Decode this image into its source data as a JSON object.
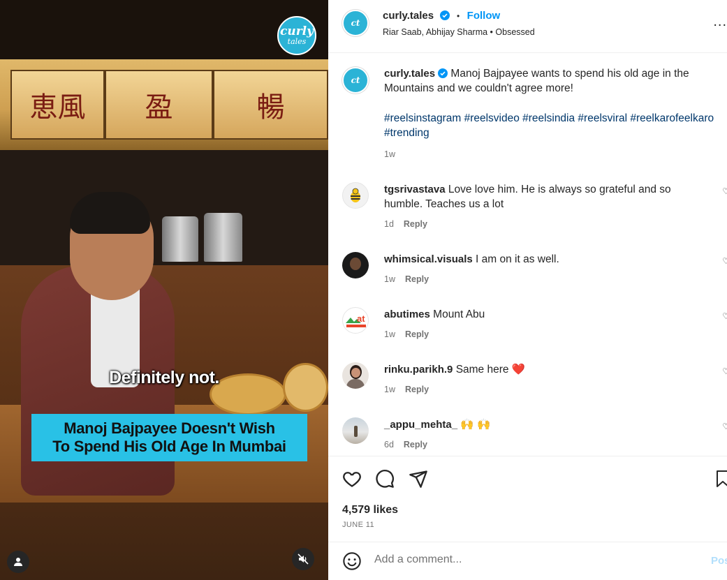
{
  "video": {
    "brand_logo_line1": "curly",
    "brand_logo_line2": "tales",
    "caption_quote": "Definitely not.",
    "title_line1": "Manoj Bajpayee Doesn't Wish",
    "title_line2": "To Spend His Old Age In Mumbai",
    "sign_glyphs": [
      "恵風",
      "盈",
      "暢"
    ],
    "accent_color": "#29c1e6"
  },
  "header": {
    "username": "curly.tales",
    "separator": "•",
    "follow_label": "Follow",
    "audio": "Riar Saab, Abhijay Sharma • Obsessed",
    "more_label": "..."
  },
  "caption": {
    "username": "curly.tales",
    "text": "Manoj Bajpayee wants to spend his old age in the Mountains and we couldn't agree more!",
    "hashtags": "#reelsinstagram #reelsvideo #reelsindia #reelsviral #reelkarofeelkaro #trending",
    "time": "1w"
  },
  "comments": [
    {
      "username": "tgsrivastava",
      "text": "Love love him. He is always so grateful and so humble. Teaches us a lot",
      "time": "1d",
      "reply": "Reply"
    },
    {
      "username": "whimsical.visuals",
      "text": "I am on it as well.",
      "time": "1w",
      "reply": "Reply"
    },
    {
      "username": "abutimes",
      "text": "Mount Abu",
      "time": "1w",
      "reply": "Reply"
    },
    {
      "username": "rinku.parikh.9",
      "text": "Same here ❤️",
      "time": "1w",
      "reply": "Reply"
    },
    {
      "username": "_appu_mehta_",
      "text": "🙌 🙌",
      "time": "6d",
      "reply": "Reply"
    }
  ],
  "stats": {
    "likes": "4,579 likes",
    "date": "JUNE 11"
  },
  "comment_box": {
    "placeholder": "Add a comment...",
    "post_label": "Post"
  }
}
